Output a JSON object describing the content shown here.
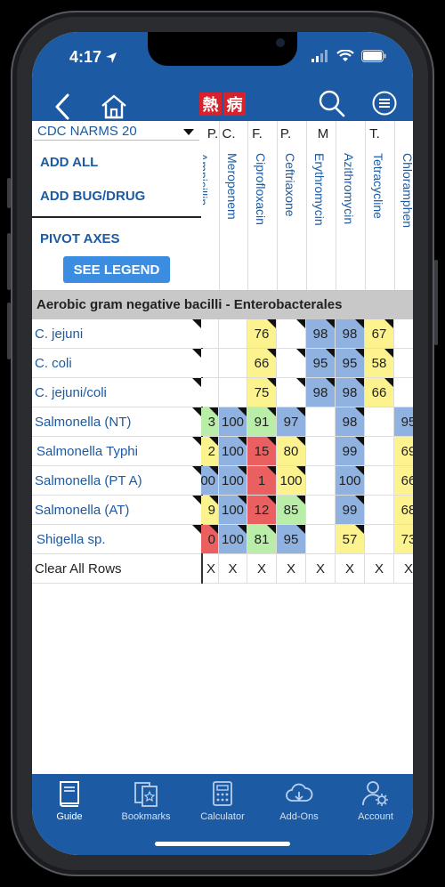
{
  "status": {
    "time": "4:17"
  },
  "nav": {},
  "logo": {
    "char1": "熱",
    "char2": "病"
  },
  "panel": {
    "dropdown_value": "CDC NARMS 20",
    "add_all": "ADD ALL",
    "add_bug_drug": "ADD BUG/DRUG",
    "pivot_axes": "PIVOT AXES",
    "see_legend": "SEE LEGEND"
  },
  "columns": [
    {
      "abbr": "P.",
      "name": "Ampicillin"
    },
    {
      "abbr": "C.",
      "name": "Meropenem"
    },
    {
      "abbr": "F.",
      "name": "Ciprofloxacin"
    },
    {
      "abbr": "P.",
      "name": "Ceftriaxone"
    },
    {
      "abbr": "M",
      "name": "Erythromycin"
    },
    {
      "abbr": "",
      "name": "Azithromycin"
    },
    {
      "abbr": "T.",
      "name": "Tetracycline"
    },
    {
      "abbr": "",
      "name": "Chloramphen"
    }
  ],
  "group_header": "Aerobic gram negative bacilli - Enterobacterales",
  "rows": [
    {
      "label": "C. jejuni",
      "cells": [
        "",
        "",
        "76",
        "",
        "98",
        "98",
        "67",
        ""
      ]
    },
    {
      "label": "C. coli",
      "cells": [
        "",
        "",
        "66",
        "",
        "95",
        "95",
        "58",
        ""
      ]
    },
    {
      "label": "C. jejuni/coli",
      "cells": [
        "",
        "",
        "75",
        "",
        "98",
        "98",
        "66",
        ""
      ]
    },
    {
      "label": "Salmonella (NT)",
      "cells": [
        "3",
        "100",
        "91",
        "97",
        "",
        "98",
        "",
        "95"
      ]
    },
    {
      "label": "Salmonella Typhi",
      "cells": [
        "2",
        "100",
        "15",
        "80",
        "",
        "99",
        "",
        "69"
      ]
    },
    {
      "label": "Salmonella (PT A)",
      "cells": [
        "00",
        "100",
        "1",
        "100",
        "",
        "100",
        "",
        "66"
      ]
    },
    {
      "label": "Salmonella (AT)",
      "cells": [
        "9",
        "100",
        "12",
        "85",
        "",
        "99",
        "",
        "68"
      ]
    },
    {
      "label": "Shigella sp.",
      "cells": [
        "0",
        "100",
        "81",
        "95",
        "",
        "57",
        "",
        "73"
      ]
    }
  ],
  "clear_row": {
    "label": "Clear All Rows",
    "cells": [
      "X",
      "X",
      "X",
      "X",
      "X",
      "X",
      "X",
      "X"
    ]
  },
  "tabs": [
    {
      "label": "Guide",
      "icon": "book-icon"
    },
    {
      "label": "Bookmarks",
      "icon": "bookmarks-icon"
    },
    {
      "label": "Calculator",
      "icon": "calculator-icon"
    },
    {
      "label": "Add-Ons",
      "icon": "cloud-download-icon"
    },
    {
      "label": "Account",
      "icon": "account-gear-icon"
    }
  ],
  "colors": {
    "brand": "#1c5ba3",
    "blue": "#8fb2e0",
    "yellow": "#fdf38e",
    "green": "#b9eda8",
    "red": "#ea6060",
    "grey_header": "#c8c8c8"
  }
}
